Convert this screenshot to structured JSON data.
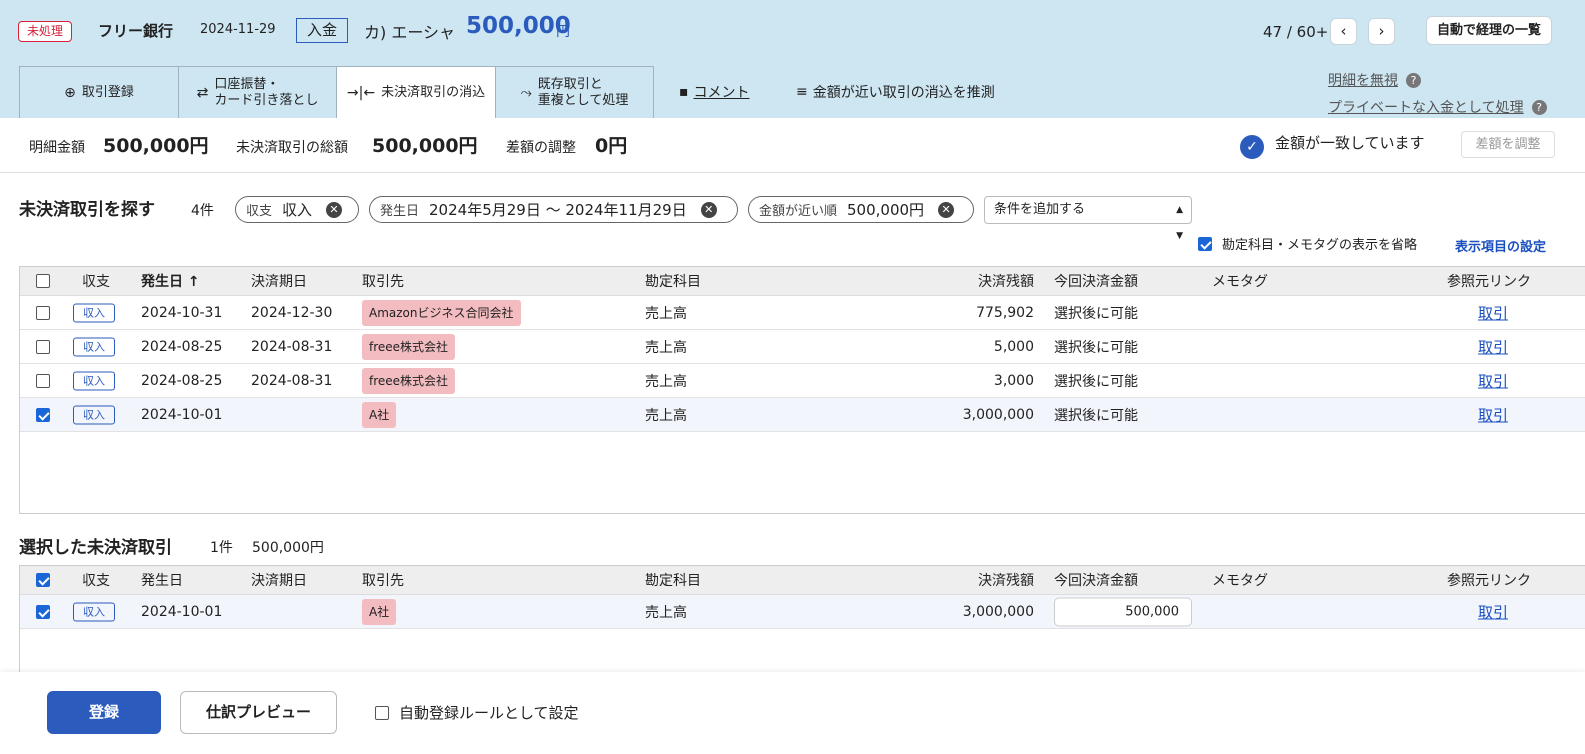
{
  "header": {
    "status": "未処理",
    "bank": "フリー銀行",
    "date": "2024-11-29",
    "kind": "入金",
    "partner": "カ) エーシャ",
    "amount": "500,000",
    "currency": "円",
    "pager": "47 / 60+",
    "prev_icon": "chevron-left-icon",
    "next_icon": "chevron-right-icon",
    "auto_list": "自動で経理の一覧"
  },
  "tabs": [
    {
      "label": "取引登録",
      "icon": "plus-circle-icon"
    },
    {
      "label1": "口座振替・",
      "label2": "カード引き落とし",
      "icon": "swap-icon"
    },
    {
      "label": "未決済取引の消込",
      "icon": "merge-icon"
    },
    {
      "label1": "既存取引と",
      "label2": "重複として処理",
      "icon": "duplicate-icon"
    }
  ],
  "links": {
    "comment": "コメント",
    "guess": "金額が近い取引の消込を推測",
    "ignore": "明細を無視",
    "private": "プライベートな入金として処理"
  },
  "summary": {
    "detail_label": "明細金額",
    "detail_value": "500,000円",
    "total_label": "未決済取引の総額",
    "total_value": "500,000円",
    "diff_label": "差額の調整",
    "diff_value": "0円",
    "match_text": "金額が一致しています",
    "adjust_button": "差額を調整"
  },
  "search": {
    "title": "未決済取引を探す",
    "count": "4件",
    "filters": [
      {
        "label": "収支",
        "value": "収入"
      },
      {
        "label": "発生日",
        "value": "2024年5月29日 〜 2024年11月29日"
      },
      {
        "label": "金額が近い順",
        "value": "500,000円"
      }
    ],
    "add_condition": "条件を追加する",
    "omit_label": "勘定科目・メモタグの表示を省略",
    "settings_link": "表示項目の設定"
  },
  "columns": {
    "type": "収支",
    "date": "発生日",
    "date_sorted": "発生日 ↑",
    "due": "決済期日",
    "partner": "取引先",
    "account": "勘定科目",
    "balance": "決済残額",
    "pay": "今回決済金額",
    "memo": "メモタグ",
    "ref": "参照元リンク"
  },
  "rows": [
    {
      "checked": false,
      "type": "収入",
      "date": "2024-10-31",
      "due": "2024-12-30",
      "partner": "Amazonビジネス合同会社",
      "account": "売上高",
      "balance": "775,902",
      "pay": "選択後に可能",
      "ref": "取引"
    },
    {
      "checked": false,
      "type": "収入",
      "date": "2024-08-25",
      "due": "2024-08-31",
      "partner": "freee株式会社",
      "account": "売上高",
      "balance": "5,000",
      "pay": "選択後に可能",
      "ref": "取引"
    },
    {
      "checked": false,
      "type": "収入",
      "date": "2024-08-25",
      "due": "2024-08-31",
      "partner": "freee株式会社",
      "account": "売上高",
      "balance": "3,000",
      "pay": "選択後に可能",
      "ref": "取引"
    },
    {
      "checked": true,
      "type": "収入",
      "date": "2024-10-01",
      "due": "",
      "partner": "A社",
      "account": "売上高",
      "balance": "3,000,000",
      "pay": "選択後に可能",
      "ref": "取引"
    }
  ],
  "selected": {
    "title": "選択した未決済取引",
    "count": "1件",
    "total": "500,000円",
    "rows": [
      {
        "checked": true,
        "type": "収入",
        "date": "2024-10-01",
        "due": "",
        "partner": "A社",
        "account": "売上高",
        "balance": "3,000,000",
        "pay_value": "500,000",
        "ref": "取引"
      }
    ]
  },
  "footer": {
    "register": "登録",
    "preview": "仕訳プレビュー",
    "auto_rule": "自動登録ルールとして設定"
  },
  "colors": {
    "accent": "#2b5bbd",
    "header_bg": "#cde6f2",
    "alert": "#d9213a",
    "partner_tag": "#f3bcc0"
  }
}
